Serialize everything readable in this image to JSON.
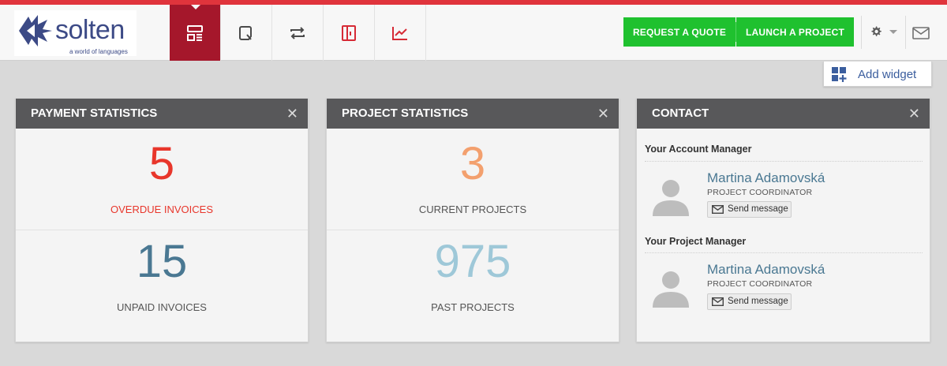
{
  "brand": {
    "name": "solten",
    "tagline": "a world of languages",
    "accent": "#e0343c",
    "active_tab_color": "#a5172b",
    "cta_color": "#1fc12f"
  },
  "nav": {
    "tabs": [
      {
        "icon": "dashboard-icon",
        "active": true
      },
      {
        "icon": "quote-icon",
        "active": false
      },
      {
        "icon": "transfer-icon",
        "active": false
      },
      {
        "icon": "invoices-icon",
        "active": false
      },
      {
        "icon": "statistics-chart-icon",
        "active": false
      }
    ]
  },
  "header": {
    "request_quote": "REQUEST A QUOTE",
    "launch_project": "LAUNCH A PROJECT",
    "settings_icon": "gear-icon",
    "messages_icon": "mail-icon"
  },
  "add_widget": {
    "label": "Add widget"
  },
  "payment": {
    "title": "PAYMENT STATISTICS",
    "overdue": {
      "value": "5",
      "label": "OVERDUE INVOICES",
      "color": "#e8362b"
    },
    "unpaid": {
      "value": "15",
      "label": "UNPAID INVOICES",
      "color": "#4a7892"
    }
  },
  "projects": {
    "title": "PROJECT STATISTICS",
    "current": {
      "value": "3",
      "label": "CURRENT PROJECTS",
      "color": "#f3a06e"
    },
    "past": {
      "value": "975",
      "label": "PAST PROJECTS",
      "color": "#9ec8d8"
    }
  },
  "contact": {
    "title": "CONTACT",
    "account_manager": {
      "heading": "Your Account Manager",
      "name": "Martina Adamovská",
      "role": "PROJECT COORDINATOR",
      "send_label": "Send message"
    },
    "project_manager": {
      "heading": "Your Project Manager",
      "name": "Martina Adamovská",
      "role": "PROJECT COORDINATOR",
      "send_label": "Send message"
    }
  },
  "close_glyph": "✕"
}
